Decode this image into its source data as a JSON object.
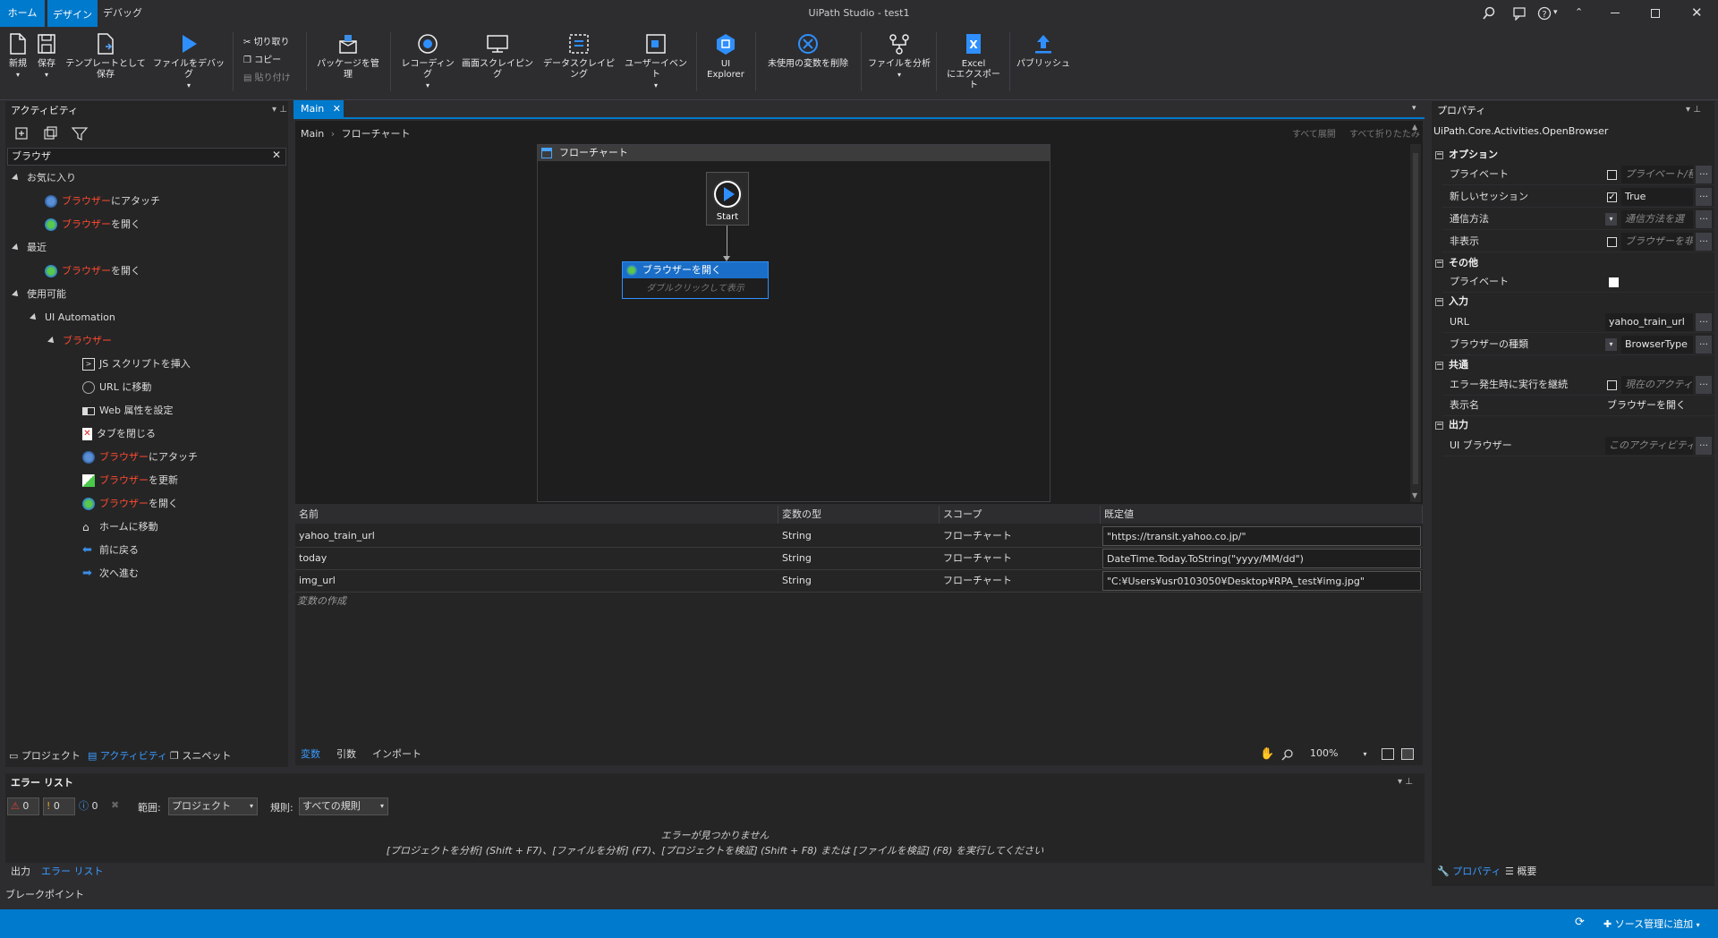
{
  "titlebar": {
    "title": "UiPath Studio - test1",
    "tabs": [
      "ホーム",
      "デザイン",
      "デバッグ"
    ]
  },
  "ribbon": {
    "new": "新規",
    "save": "保存",
    "save_template": "テンプレートとして保存",
    "debug_file": "ファイルをデバッグ",
    "cut": "切り取り",
    "copy": "コピー",
    "paste": "貼り付け",
    "manage_packages": "パッケージを管理",
    "recording": "レコーディング",
    "screen_scraping": "画面スクレイピング",
    "data_scraping": "データスクレイピング",
    "user_events": "ユーザーイベント",
    "ui_explorer_1": "UI",
    "ui_explorer_2": "Explorer",
    "remove_unused": "未使用の変数を削除",
    "analyze_file": "ファイルを分析",
    "excel_export_1": "Excel",
    "excel_export_2": "にエクスポート",
    "publish": "パブリッシュ"
  },
  "activities": {
    "header": "アクティビティ",
    "search_value": "ブラウザ",
    "favorites": "お気に入り",
    "recent": "最近",
    "available": "使用可能",
    "ui_automation": "UI Automation",
    "browser_group": "ブラウザー",
    "highlight": "ブラウザー",
    "fav_items": [
      {
        "rest": "にアタッチ"
      },
      {
        "rest": "を開く"
      }
    ],
    "recent_items": [
      {
        "rest": "を開く"
      }
    ],
    "browser_items": [
      {
        "label": "JS スクリプトを挿入"
      },
      {
        "label": "URL に移動"
      },
      {
        "label": "Web 属性を設定"
      },
      {
        "label": "タブを閉じる"
      },
      {
        "hl": "ブラウザー",
        "label": "にアタッチ"
      },
      {
        "hl": "ブラウザー",
        "label": "を更新"
      },
      {
        "hl": "ブラウザー",
        "label": "を開く"
      },
      {
        "label": "ホームに移動"
      },
      {
        "label": "前に戻る"
      },
      {
        "label": "次へ進む"
      }
    ],
    "bottom_tabs": [
      "プロジェクト",
      "アクティビティ",
      "スニペット"
    ]
  },
  "designer": {
    "tab": "Main",
    "breadcrumb_main": "Main",
    "breadcrumb_flow": "フローチャート",
    "expand_all": "すべて展開",
    "collapse_all": "すべて折りたたみ",
    "flowchart_title": "フローチャート",
    "start_label": "Start",
    "activity_title": "ブラウザーを開く",
    "activity_hint": "ダブルクリックして表示"
  },
  "variables": {
    "headers": [
      "名前",
      "変数の型",
      "スコープ",
      "既定値"
    ],
    "rows": [
      {
        "name": "yahoo_train_url",
        "type": "String",
        "scope": "フローチャート",
        "default": "\"https://transit.yahoo.co.jp/\""
      },
      {
        "name": "today",
        "type": "String",
        "scope": "フローチャート",
        "default": "DateTime.Today.ToString(\"yyyy/MM/dd\")"
      },
      {
        "name": "img_url",
        "type": "String",
        "scope": "フローチャート",
        "default": "\"C:¥Users¥usr0103050¥Desktop¥RPA_test¥img.jpg\""
      }
    ],
    "create": "変数の作成",
    "tabs": [
      "変数",
      "引数",
      "インポート"
    ],
    "zoom": "100%"
  },
  "properties": {
    "header": "プロパティ",
    "class": "UiPath.Core.Activities.OpenBrowser",
    "sections": {
      "options": "オプション",
      "misc": "その他",
      "input": "入力",
      "common": "共通",
      "output": "出力"
    },
    "rows": {
      "private": {
        "name": "プライベート",
        "value": "プライベート/種"
      },
      "new_session": {
        "name": "新しいセッション",
        "value": "True"
      },
      "comm": {
        "name": "通信方法",
        "value": "通信方法を選"
      },
      "hidden": {
        "name": "非表示",
        "value": "ブラウザーを非"
      },
      "misc_private": {
        "name": "プライベート"
      },
      "url": {
        "name": "URL",
        "value": "yahoo_train_url"
      },
      "browser_type": {
        "name": "ブラウザーの種類",
        "value": "BrowserType"
      },
      "continue": {
        "name": "エラー発生時に実行を継続",
        "value": "現在のアクティ"
      },
      "display": {
        "name": "表示名",
        "value": "ブラウザーを開く"
      },
      "ui_browser": {
        "name": "UI ブラウザー",
        "value": "このアクティビティカ"
      }
    },
    "tabs": [
      "プロパティ",
      "概要"
    ]
  },
  "errors": {
    "header": "エラー リスト",
    "count_error": "0",
    "count_warning": "0",
    "count_info": "0",
    "scope_label": "範囲:",
    "scope_value": "プロジェクト",
    "rule_label": "規則:",
    "rule_value": "すべての規則",
    "msg1": "エラーが見つかりません",
    "msg2": "[プロジェクトを分析] (Shift + F7)、[ファイルを分析] (F7)、[プロジェクトを検証] (Shift + F8) または [ファイルを検証] (F8) を実行してください",
    "tabs": [
      "出力",
      "エラー リスト"
    ],
    "breakpoints": "ブレークポイント"
  },
  "statusbar": {
    "source_control": "ソース管理に追加"
  },
  "colors": {
    "accent": "#007acc",
    "highlight": "#ff4a2e",
    "background": "#2d2d30"
  }
}
